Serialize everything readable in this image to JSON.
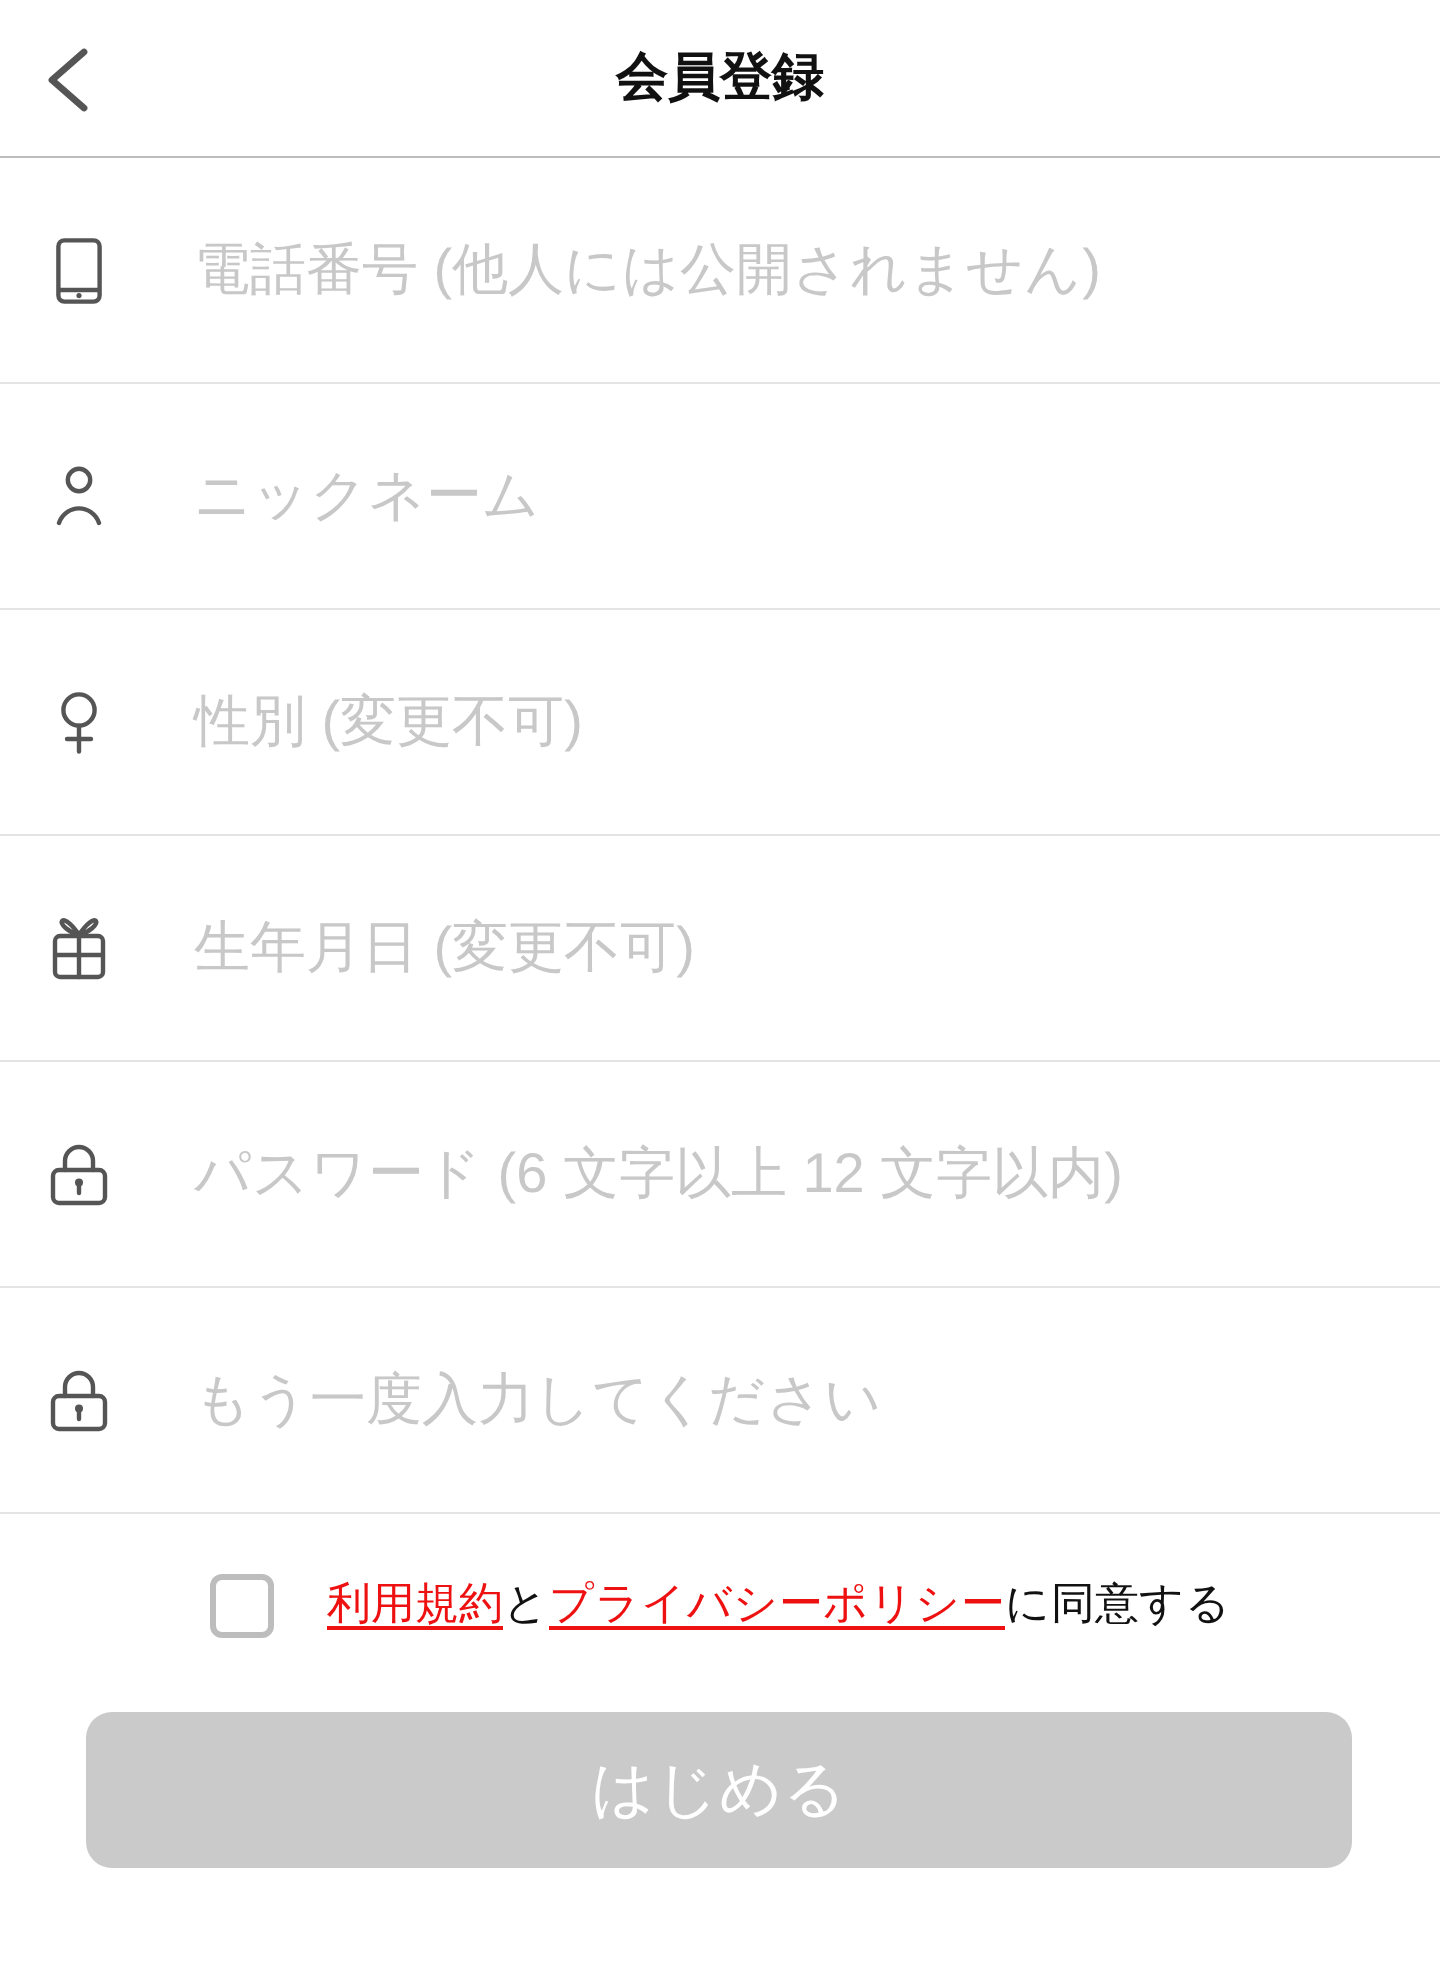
{
  "header": {
    "title": "会員登録"
  },
  "fields": [
    {
      "kind": "phone",
      "placeholder": "電話番号 (他人には公開されません)"
    },
    {
      "kind": "nickname",
      "placeholder": "ニックネーム"
    },
    {
      "kind": "gender",
      "placeholder": "性別 (変更不可)"
    },
    {
      "kind": "birthday",
      "placeholder": "生年月日 (変更不可)"
    },
    {
      "kind": "password",
      "placeholder": "パスワード (6 文字以上 12 文字以内)"
    },
    {
      "kind": "password_confirm",
      "placeholder": "もう一度入力してください"
    }
  ],
  "agreement": {
    "checked": false,
    "parts": [
      {
        "kind": "link",
        "text": "利用規約"
      },
      {
        "kind": "text",
        "text": "と"
      },
      {
        "kind": "link",
        "text": "プライバシーポリシー"
      },
      {
        "kind": "text",
        "text": "に同意する"
      }
    ]
  },
  "submit": {
    "label": "はじめる",
    "disabled": true
  }
}
